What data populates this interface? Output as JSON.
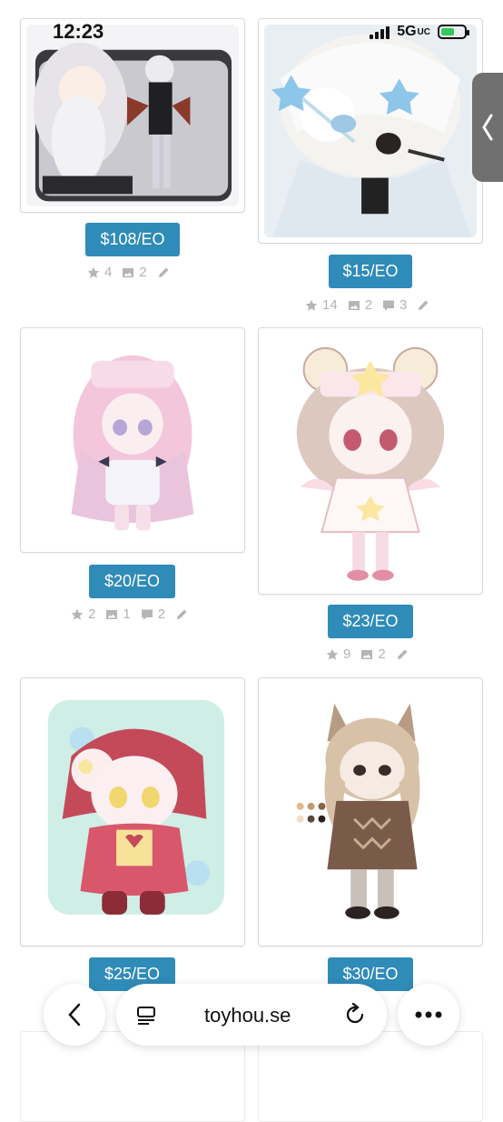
{
  "status_bar": {
    "time": "12:23",
    "network": "5G",
    "network_suffix": "UC"
  },
  "listings": [
    {
      "price": "$108/EO",
      "stats": [
        {
          "icon": "star-icon",
          "count": "4"
        },
        {
          "icon": "image-icon",
          "count": "2"
        },
        {
          "icon": "pencil-icon",
          "count": ""
        }
      ]
    },
    {
      "price": "$15/EO",
      "stats": [
        {
          "icon": "star-icon",
          "count": "14"
        },
        {
          "icon": "image-icon",
          "count": "2"
        },
        {
          "icon": "comment-icon",
          "count": "3"
        },
        {
          "icon": "pencil-icon",
          "count": ""
        }
      ]
    },
    {
      "price": "$20/EO",
      "stats": [
        {
          "icon": "star-icon",
          "count": "2"
        },
        {
          "icon": "image-icon",
          "count": "1"
        },
        {
          "icon": "comment-icon",
          "count": "2"
        },
        {
          "icon": "pencil-icon",
          "count": ""
        }
      ]
    },
    {
      "price": "$23/EO",
      "stats": [
        {
          "icon": "star-icon",
          "count": "9"
        },
        {
          "icon": "image-icon",
          "count": "2"
        },
        {
          "icon": "pencil-icon",
          "count": ""
        }
      ]
    },
    {
      "price": "$25/EO",
      "stats": []
    },
    {
      "price": "$30/EO",
      "stats": []
    }
  ],
  "browser": {
    "url": "toyhou.se"
  },
  "colors": {
    "price_button": "#2f8bb8",
    "stats_text": "#b3b3b3"
  }
}
